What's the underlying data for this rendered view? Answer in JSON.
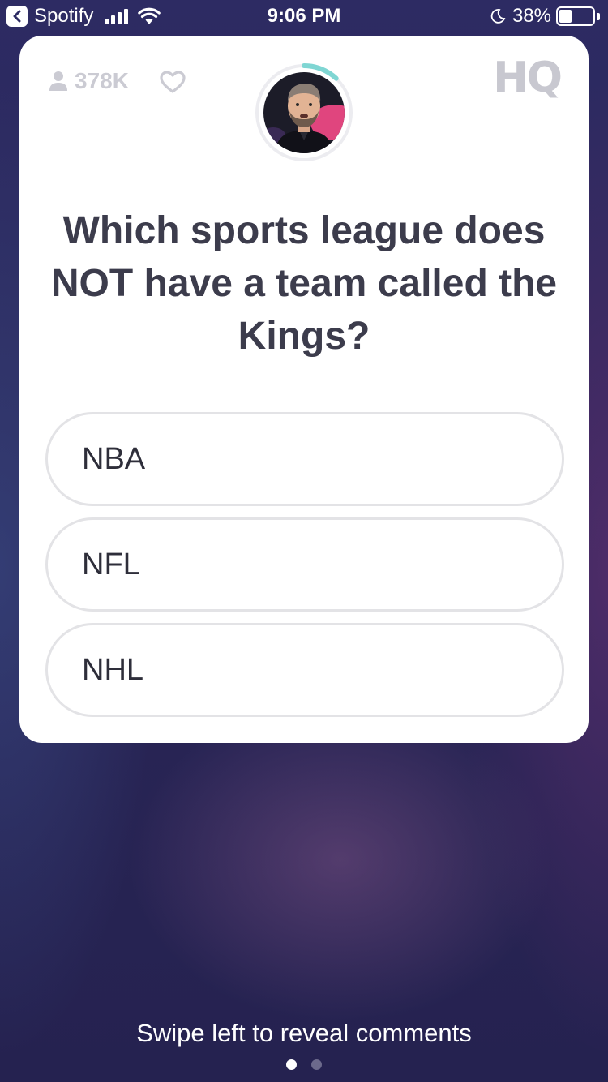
{
  "status_bar": {
    "back_app": "Spotify",
    "time": "9:06 PM",
    "battery": "38%",
    "battery_level": 0.38
  },
  "card": {
    "viewer_count": "378K",
    "logo": "HQ",
    "question": "Which sports league does NOT have a team called the Kings?",
    "answers": [
      {
        "label": "NBA"
      },
      {
        "label": "NFL"
      },
      {
        "label": "NHL"
      }
    ],
    "timer_progress": 0.12
  },
  "footer": {
    "hint": "Swipe left to reveal comments",
    "page_count": 2,
    "active_page": 1
  },
  "colors": {
    "background": "#28244e",
    "card": "#ffffff",
    "question_text": "#3c3c4c",
    "answer_border": "#e3e3e6",
    "timer_ring": "#7fd6d3",
    "muted": "#cbcbd3"
  },
  "icons": [
    "back-icon",
    "signal-icon",
    "wifi-icon",
    "moon-icon",
    "battery-icon",
    "person-icon",
    "heart-icon"
  ]
}
